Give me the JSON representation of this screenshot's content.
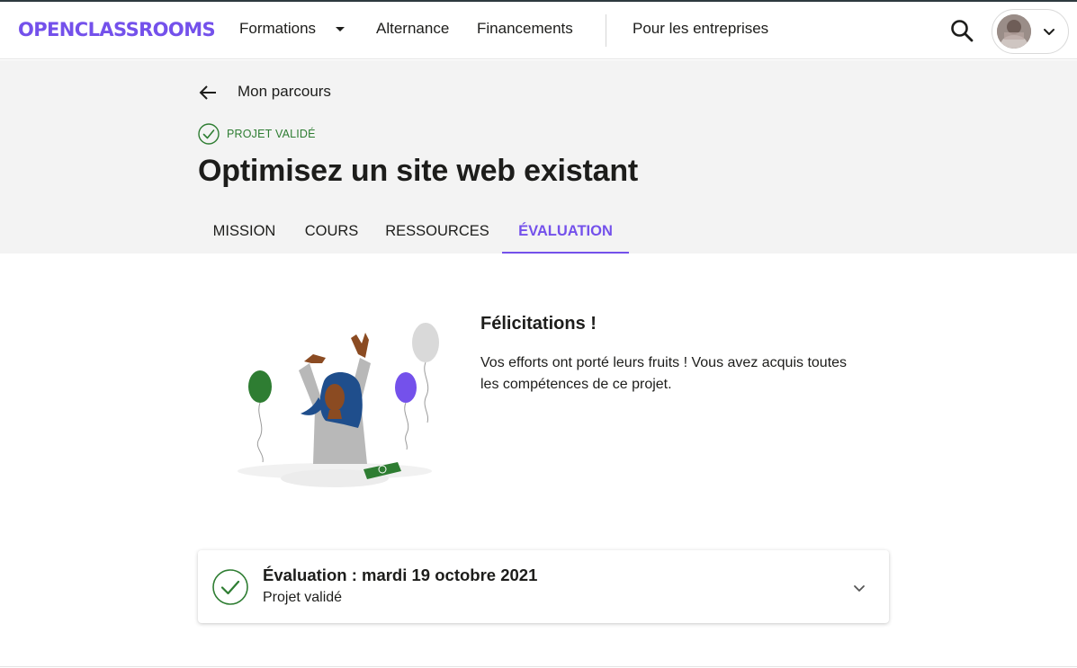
{
  "navbar": {
    "logo": "OPENCLASSROOMS",
    "items": [
      {
        "label": "Formations"
      },
      {
        "label": "Alternance"
      },
      {
        "label": "Financements"
      },
      {
        "label": "Pour les entreprises"
      }
    ],
    "search_icon": "search-icon",
    "user_menu_icon": "chevron-down-icon"
  },
  "header": {
    "back_label": "Mon parcours",
    "status": "PROJET VALIDÉ",
    "title": "Optimisez un site web existant",
    "tabs": [
      {
        "label": "MISSION",
        "active": false
      },
      {
        "label": "COURS",
        "active": false
      },
      {
        "label": "RESSOURCES",
        "active": false
      },
      {
        "label": "ÉVALUATION",
        "active": true
      }
    ]
  },
  "main": {
    "congrats_title": "Félicitations !",
    "congrats_text": "Vos efforts ont porté leurs fruits ! Vous avez acquis toutes les compétences de ce projet.",
    "evaluation": {
      "title": "Évaluation : mardi 19 octobre 2021",
      "subtitle": "Projet validé"
    }
  },
  "colors": {
    "brand": "#7451eb",
    "success": "#2e7d32",
    "hero_bg": "#f3f3f3",
    "text": "#1d1d1b"
  }
}
